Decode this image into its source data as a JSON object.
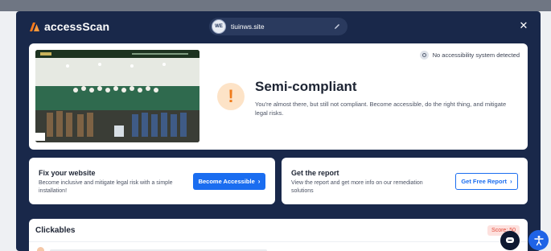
{
  "app": {
    "brand": "accessScan",
    "site_avatar": "WE",
    "site_name": "tiuinws.site",
    "close_icon": "close-icon",
    "edit_icon": "pencil-icon"
  },
  "hero": {
    "detection_text": "No accessibility system detected",
    "status_title": "Semi-compliant",
    "status_icon": "!",
    "status_description": "You're almost there, but still not compliant. Become accessible, do the right thing, and mitigate legal risks."
  },
  "cards": {
    "fix": {
      "title": "Fix your website",
      "description": "Become inclusive and mitigate legal risk with a simple installation!",
      "button_label": "Become Accessible"
    },
    "report": {
      "title": "Get the report",
      "description": "View the report and get more info on our remediation solutions",
      "button_label": "Get Free Report"
    }
  },
  "clickables": {
    "title": "Clickables",
    "score": "Score: 50"
  },
  "colors": {
    "panel": "#19284a",
    "accent_blue": "#1a6df0",
    "warning_orange": "#ef7b1b",
    "score_red": "#e34a3a"
  }
}
